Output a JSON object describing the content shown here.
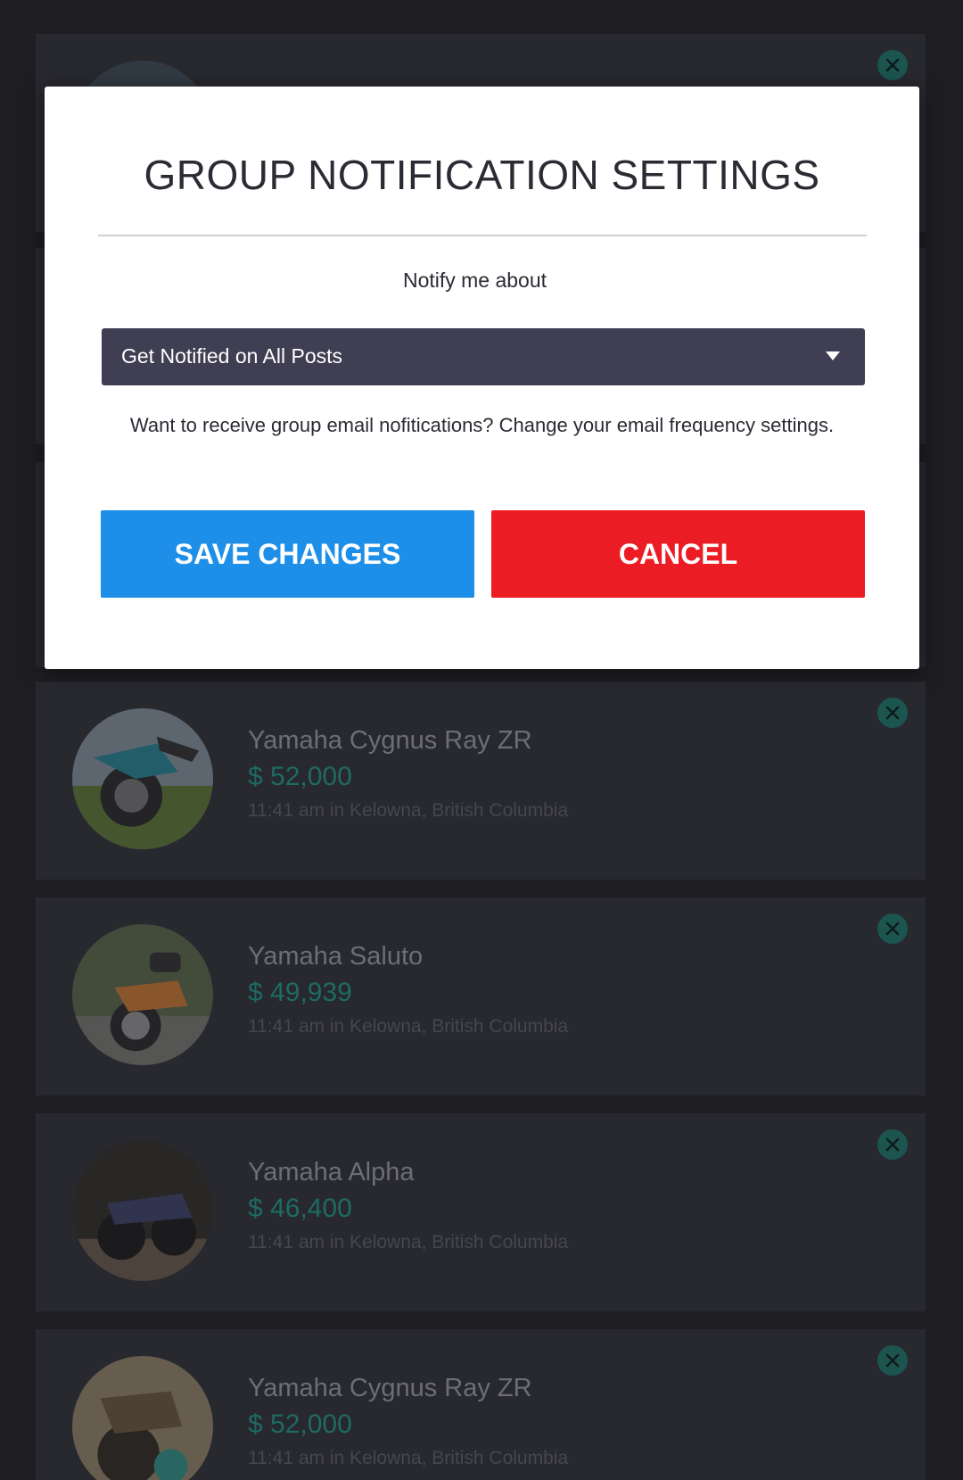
{
  "modal": {
    "title": "GROUP NOTIFICATION SETTINGS",
    "notify_label": "Notify me about",
    "select_value": "Get Notified on All Posts",
    "hint": "Want to receive group email nofitications? Change your email frequency settings.",
    "save_label": "SAVE CHANGES",
    "cancel_label": "CANCEL"
  },
  "listings": [
    {
      "title": "Yamaha Cygnus Ray ZR",
      "price": "$ 52,000",
      "meta": "11:41 am in Kelowna, British Columbia",
      "image": "motorcycle-teal"
    },
    {
      "title": "Yamaha Saluto",
      "price": "$ 49,939",
      "meta": "11:41 am in Kelowna, British Columbia",
      "image": "motorcycle-orange"
    },
    {
      "title": "Yamaha Alpha",
      "price": "$ 46,400",
      "meta": "11:41 am in Kelowna, British Columbia",
      "image": "motorcycle-dark"
    },
    {
      "title": "Yamaha Cygnus Ray ZR",
      "price": "$ 52,000",
      "meta": "11:41 am in Kelowna, British Columbia",
      "image": "motorcycle-vintage"
    }
  ],
  "colors": {
    "save_button": "#1e8fe8",
    "cancel_button": "#ec1c24",
    "select_bg": "#3f3e52",
    "price": "#1d6b62",
    "remove_icon": "#1c5550"
  },
  "icons": {
    "remove": "close-circle-icon",
    "dropdown": "caret-down-icon"
  }
}
